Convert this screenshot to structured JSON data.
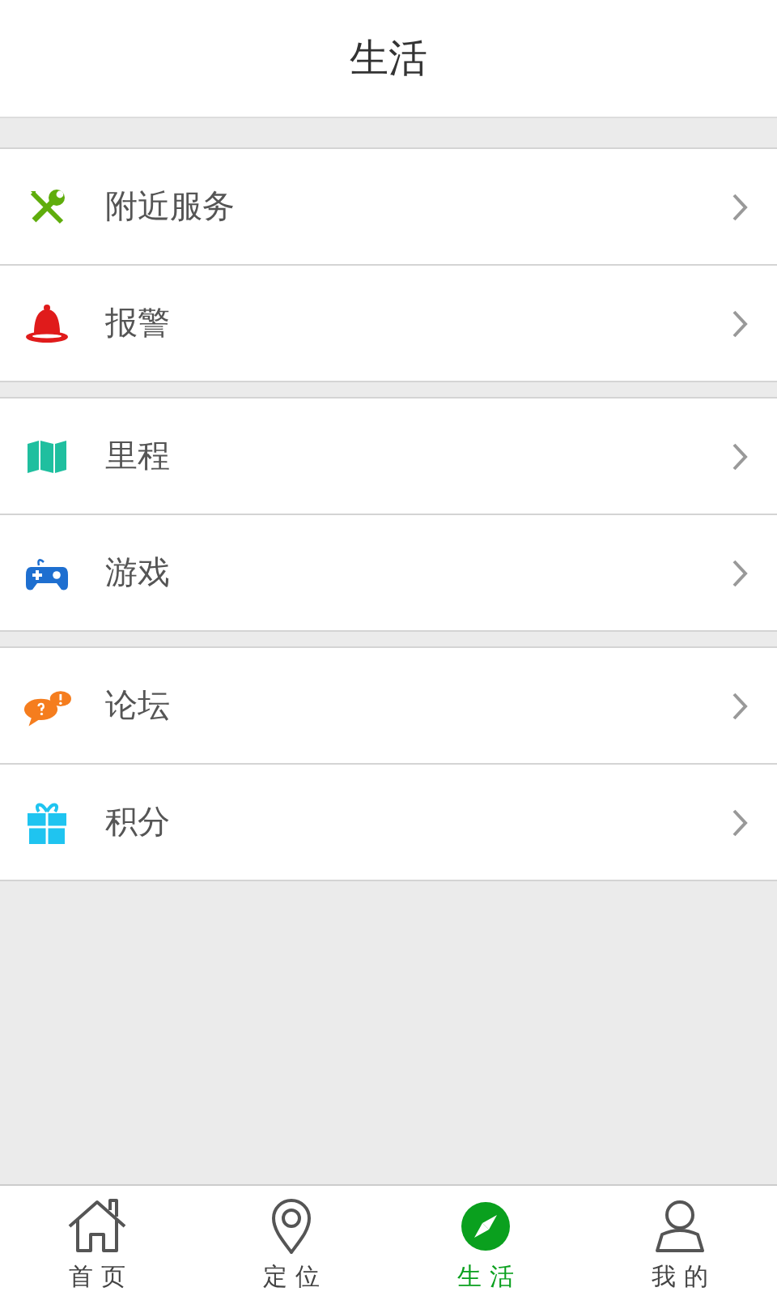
{
  "header": {
    "title": "生活"
  },
  "groups": [
    {
      "items": [
        {
          "label": "附近服务"
        },
        {
          "label": "报警"
        }
      ]
    },
    {
      "items": [
        {
          "label": "里程"
        },
        {
          "label": "游戏"
        }
      ]
    },
    {
      "items": [
        {
          "label": "论坛"
        },
        {
          "label": "积分"
        }
      ]
    }
  ],
  "tabs": [
    {
      "label": "首 页",
      "selected": false
    },
    {
      "label": "定 位",
      "selected": false
    },
    {
      "label": "生 活",
      "selected": true
    },
    {
      "label": "我 的",
      "selected": false
    }
  ]
}
